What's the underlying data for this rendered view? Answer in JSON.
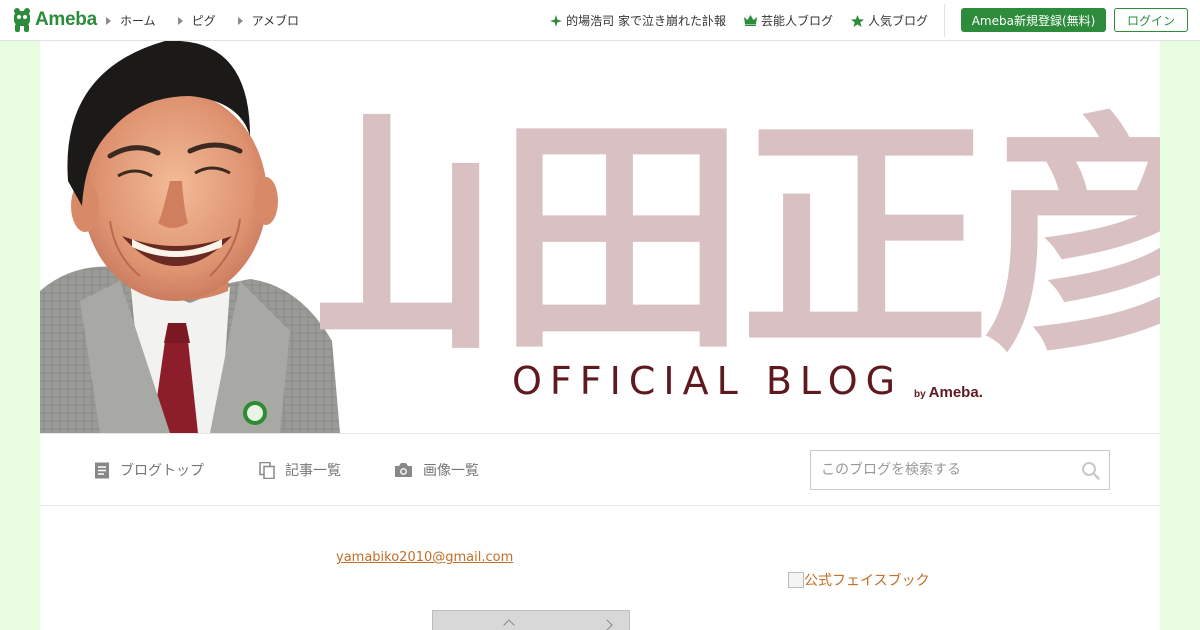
{
  "topbar": {
    "logo_text": "Ameba",
    "nav": [
      {
        "label": "ホーム"
      },
      {
        "label": "ピグ"
      },
      {
        "label": "アメブロ"
      }
    ],
    "links": [
      {
        "label": "的場浩司 家で泣き崩れた訃報",
        "icon": "sparkle-icon"
      },
      {
        "label": "芸能人ブログ",
        "icon": "crown-icon"
      },
      {
        "label": "人気ブログ",
        "icon": "star-icon"
      }
    ],
    "register_label": "Ameba新規登録(無料)",
    "login_label": "ログイン"
  },
  "banner": {
    "title_kanji": "山田正彦",
    "official_text": "OFFICIAL BLOG",
    "by_text": "by",
    "brand_text": "Ameba."
  },
  "blognav": {
    "items": [
      {
        "label": "ブログトップ",
        "icon": "document-icon"
      },
      {
        "label": "記事一覧",
        "icon": "copy-icon"
      },
      {
        "label": "画像一覧",
        "icon": "camera-icon"
      }
    ],
    "search_placeholder": "このブログを検索する"
  },
  "content": {
    "email": "yamabiko2010@gmail.com",
    "facebook_link": "公式フェイスブック"
  },
  "colors": {
    "brand_green": "#2d8c3c",
    "link_orange": "#c36d26",
    "page_bg": "#e8fde0"
  }
}
